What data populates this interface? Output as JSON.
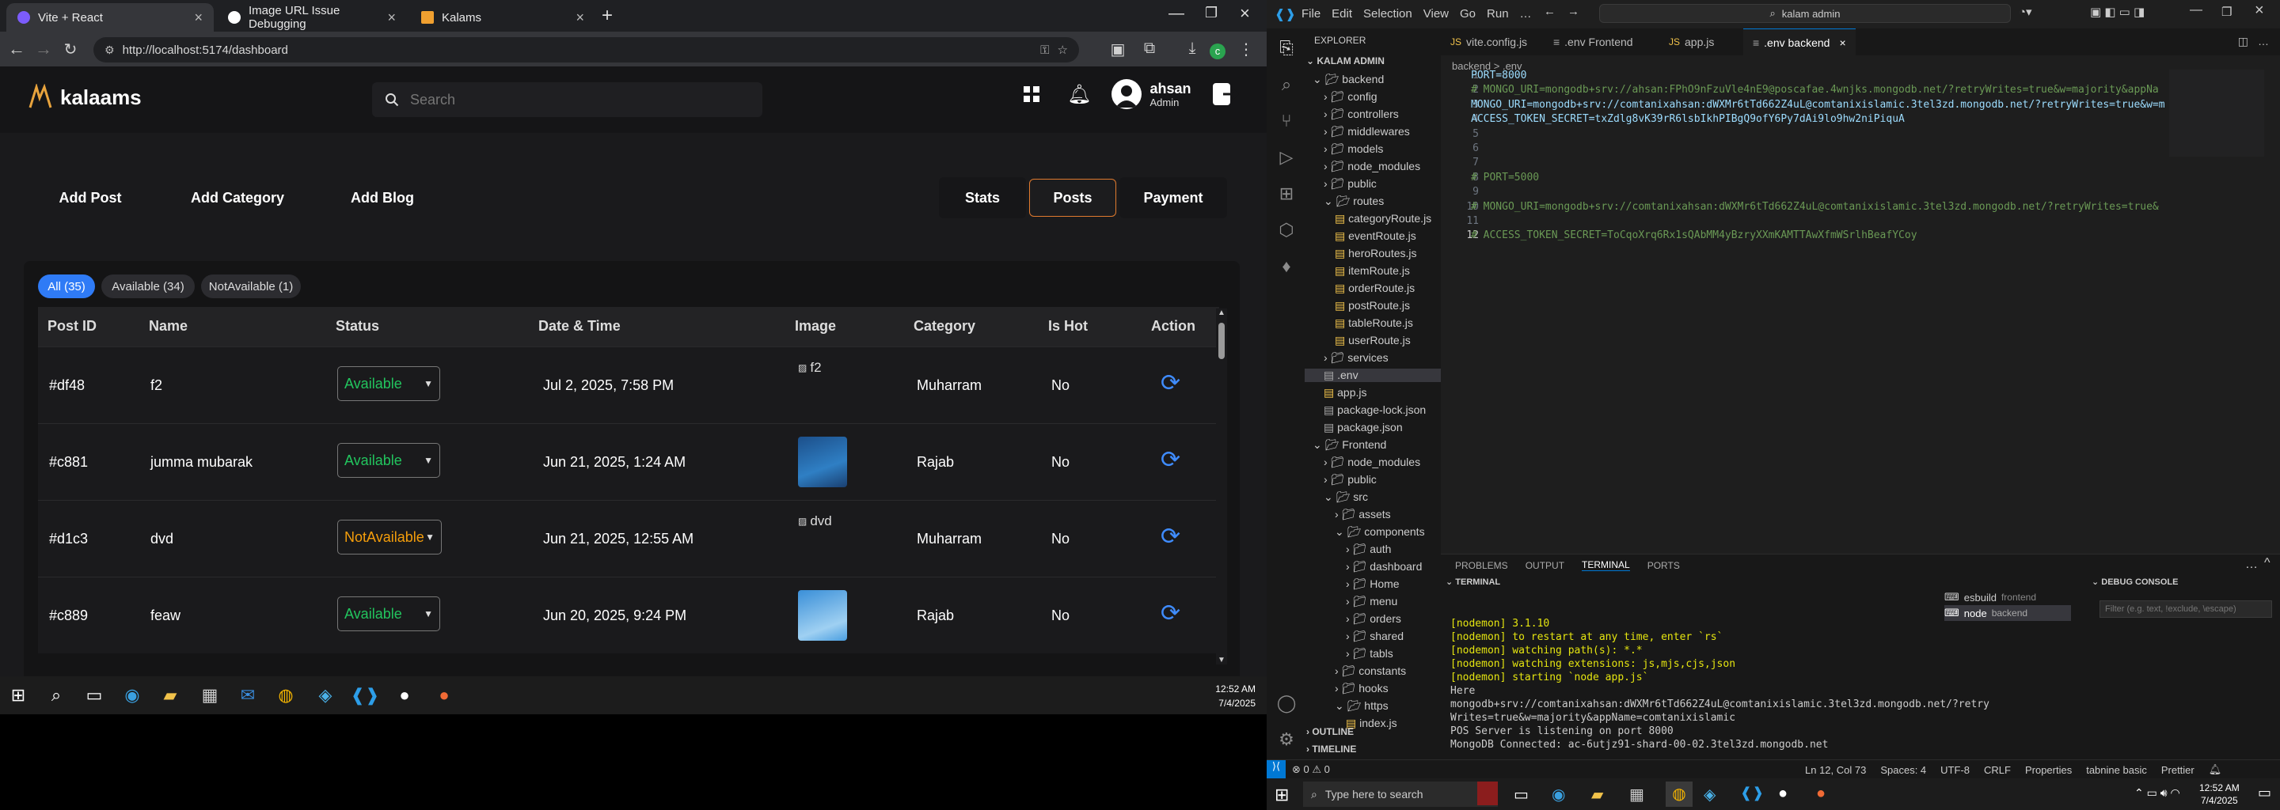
{
  "browser": {
    "tabs": [
      {
        "title": "Vite + React",
        "active": true,
        "color": "#7c5cfc"
      },
      {
        "title": "Image URL Issue Debugging",
        "active": false,
        "color": "#ffffff"
      },
      {
        "title": "Kalams",
        "active": false,
        "color": "#f0a030"
      }
    ],
    "url": "http://localhost:5174/dashboard"
  },
  "app": {
    "logo": "kalaams",
    "search_placeholder": "Search",
    "user_name": "ahsan",
    "user_role": "Admin",
    "left_actions": [
      "Add Post",
      "Add Category",
      "Add Blog"
    ],
    "right_tabs": [
      "Stats",
      "Posts",
      "Payment"
    ],
    "active_tab": "Posts",
    "filters": [
      "All (35)",
      "Available (34)",
      "NotAvailable (1)"
    ],
    "columns": [
      "Post ID",
      "Name",
      "Status",
      "Date & Time",
      "Image",
      "Category",
      "Is Hot",
      "Action"
    ],
    "rows": [
      {
        "id": "#df48",
        "name": "f2",
        "status": "Available",
        "date": "Jul 2, 2025, 7:58 PM",
        "image_alt": "f2",
        "broken": true,
        "category": "Muharram",
        "hot": "No"
      },
      {
        "id": "#c881",
        "name": "jumma mubarak",
        "status": "Available",
        "date": "Jun 21, 2025, 1:24 AM",
        "image_alt": "",
        "broken": false,
        "category": "Rajab",
        "hot": "No"
      },
      {
        "id": "#d1c3",
        "name": "dvd",
        "status": "NotAvailable",
        "date": "Jun 21, 2025, 12:55 AM",
        "image_alt": "dvd",
        "broken": true,
        "category": "Muharram",
        "hot": "No"
      },
      {
        "id": "#c889",
        "name": "feaw",
        "status": "Available",
        "date": "Jun 20, 2025, 9:24 PM",
        "image_alt": "",
        "broken": false,
        "category": "Rajab",
        "hot": "No"
      }
    ],
    "status_colors": {
      "Available": "#22c55e",
      "NotAvailable": "#f59e0b"
    }
  },
  "taskbar_left": {
    "time": "12:52 AM",
    "date": "7/4/2025"
  },
  "vscode": {
    "menu": [
      "File",
      "Edit",
      "Selection",
      "View",
      "Go",
      "Run"
    ],
    "search": "kalam admin",
    "explorer_title": "EXPLORER",
    "root": "KALAM ADMIN",
    "tree": [
      {
        "label": "backend",
        "depth": 0,
        "kind": "folder-open"
      },
      {
        "label": "config",
        "depth": 1,
        "kind": "folder"
      },
      {
        "label": "controllers",
        "depth": 1,
        "kind": "folder"
      },
      {
        "label": "middlewares",
        "depth": 1,
        "kind": "folder"
      },
      {
        "label": "models",
        "depth": 1,
        "kind": "folder"
      },
      {
        "label": "node_modules",
        "depth": 1,
        "kind": "folder"
      },
      {
        "label": "public",
        "depth": 1,
        "kind": "folder"
      },
      {
        "label": "routes",
        "depth": 1,
        "kind": "folder-open"
      },
      {
        "label": "categoryRoute.js",
        "depth": 2,
        "kind": "file"
      },
      {
        "label": "eventRoute.js",
        "depth": 2,
        "kind": "file"
      },
      {
        "label": "heroRoutes.js",
        "depth": 2,
        "kind": "file"
      },
      {
        "label": "itemRoute.js",
        "depth": 2,
        "kind": "file"
      },
      {
        "label": "orderRoute.js",
        "depth": 2,
        "kind": "file"
      },
      {
        "label": "postRoute.js",
        "depth": 2,
        "kind": "file"
      },
      {
        "label": "tableRoute.js",
        "depth": 2,
        "kind": "file"
      },
      {
        "label": "userRoute.js",
        "depth": 2,
        "kind": "file"
      },
      {
        "label": "services",
        "depth": 1,
        "kind": "folder"
      },
      {
        "label": ".env",
        "depth": 1,
        "kind": "file",
        "selected": true
      },
      {
        "label": "app.js",
        "depth": 1,
        "kind": "file"
      },
      {
        "label": "package-lock.json",
        "depth": 1,
        "kind": "file"
      },
      {
        "label": "package.json",
        "depth": 1,
        "kind": "file"
      },
      {
        "label": "Frontend",
        "depth": 0,
        "kind": "folder-open"
      },
      {
        "label": "node_modules",
        "depth": 1,
        "kind": "folder"
      },
      {
        "label": "public",
        "depth": 1,
        "kind": "folder"
      },
      {
        "label": "src",
        "depth": 1,
        "kind": "folder-open"
      },
      {
        "label": "assets",
        "depth": 2,
        "kind": "folder"
      },
      {
        "label": "components",
        "depth": 2,
        "kind": "folder-open"
      },
      {
        "label": "auth",
        "depth": 3,
        "kind": "folder"
      },
      {
        "label": "dashboard",
        "depth": 3,
        "kind": "folder"
      },
      {
        "label": "Home",
        "depth": 3,
        "kind": "folder"
      },
      {
        "label": "menu",
        "depth": 3,
        "kind": "folder"
      },
      {
        "label": "orders",
        "depth": 3,
        "kind": "folder"
      },
      {
        "label": "shared",
        "depth": 3,
        "kind": "folder"
      },
      {
        "label": "tabls",
        "depth": 3,
        "kind": "folder"
      },
      {
        "label": "constants",
        "depth": 2,
        "kind": "folder"
      },
      {
        "label": "hooks",
        "depth": 2,
        "kind": "folder"
      },
      {
        "label": "https",
        "depth": 2,
        "kind": "folder-open"
      },
      {
        "label": "index.js",
        "depth": 3,
        "kind": "file"
      }
    ],
    "outline": "OUTLINE",
    "timeline": "TIMELINE",
    "editor_tabs": [
      {
        "label": "vite.config.js",
        "active": false
      },
      {
        "label": ".env Frontend",
        "active": false
      },
      {
        "label": "app.js",
        "active": false
      },
      {
        "label": ".env backend",
        "active": true
      }
    ],
    "breadcrumb": "backend > .env",
    "lines": [
      {
        "n": "1",
        "t": "PORT=8000",
        "comment": false
      },
      {
        "n": "2",
        "t": "# MONGO_URI=mongodb+srv://ahsan:FPhO9nFzuVle4nE9@poscafae.4wnjks.mongodb.net/?retryWrites=true&w=majority&appNa",
        "comment": true
      },
      {
        "n": "3",
        "t": "MONGO_URI=mongodb+srv://comtanixahsan:dWXMr6tTd662Z4uL@comtanixislamic.3tel3zd.mongodb.net/?retryWrites=true&w=m",
        "comment": false
      },
      {
        "n": "4",
        "t": "ACCESS_TOKEN_SECRET=txZdlg8vK39rR6lsbIkhPIBgQ9ofY6Py7dAi9lo9hw2niPiquA",
        "comment": false
      },
      {
        "n": "5",
        "t": "",
        "comment": false
      },
      {
        "n": "6",
        "t": "",
        "comment": false
      },
      {
        "n": "7",
        "t": "",
        "comment": false
      },
      {
        "n": "8",
        "t": "# PORT=5000",
        "comment": true
      },
      {
        "n": "9",
        "t": "",
        "comment": false
      },
      {
        "n": "10",
        "t": "# MONGO_URI=mongodb+srv://comtanixahsan:dWXMr6tTd662Z4uL@comtanixislamic.3tel3zd.mongodb.net/?retryWrites=true&",
        "comment": true
      },
      {
        "n": "11",
        "t": "",
        "comment": false
      },
      {
        "n": "12",
        "t": "# ACCESS_TOKEN_SECRET=ToCqoXrq6Rx1sQAbMM4yBzryXXmKAMTTAwXfmWSrlhBeafYCoy",
        "comment": true
      }
    ],
    "panel_tabs": [
      "PROBLEMS",
      "OUTPUT",
      "TERMINAL",
      "PORTS"
    ],
    "terminal_label": "TERMINAL",
    "debug_label": "DEBUG CONSOLE",
    "debug_filter_placeholder": "Filter (e.g. text, !exclude, \\escape)",
    "terminals": [
      {
        "name": "esbuild",
        "sub": "frontend"
      },
      {
        "name": "node",
        "sub": "backend"
      }
    ],
    "terminal_lines": [
      "[nodemon] 3.1.10",
      "[nodemon] to restart at any time, enter `rs`",
      "[nodemon] watching path(s): *.*",
      "[nodemon] watching extensions: js,mjs,cjs,json",
      "[nodemon] starting `node app.js`",
      "Here",
      "mongodb+srv://comtanixahsan:dWXMr6tTd662Z4uL@comtanixislamic.3tel3zd.mongodb.net/?retry",
      "Writes=true&w=majority&appName=comtanixislamic",
      "POS Server is listening on port 8000",
      "MongoDB Connected: ac-6utjz91-shard-00-02.3tel3zd.mongodb.net"
    ],
    "status": {
      "left": "⊗ 0 ⚠ 0",
      "cursor": "Ln 12, Col 73",
      "spaces": "Spaces: 4",
      "encoding": "UTF-8",
      "eol": "CRLF",
      "lang": "Properties",
      "tabnine": "tabnine basic",
      "prettier": "Prettier"
    }
  },
  "taskbar_right": {
    "search_placeholder": "Type here to search",
    "time": "12:52 AM",
    "date": "7/4/2025"
  }
}
